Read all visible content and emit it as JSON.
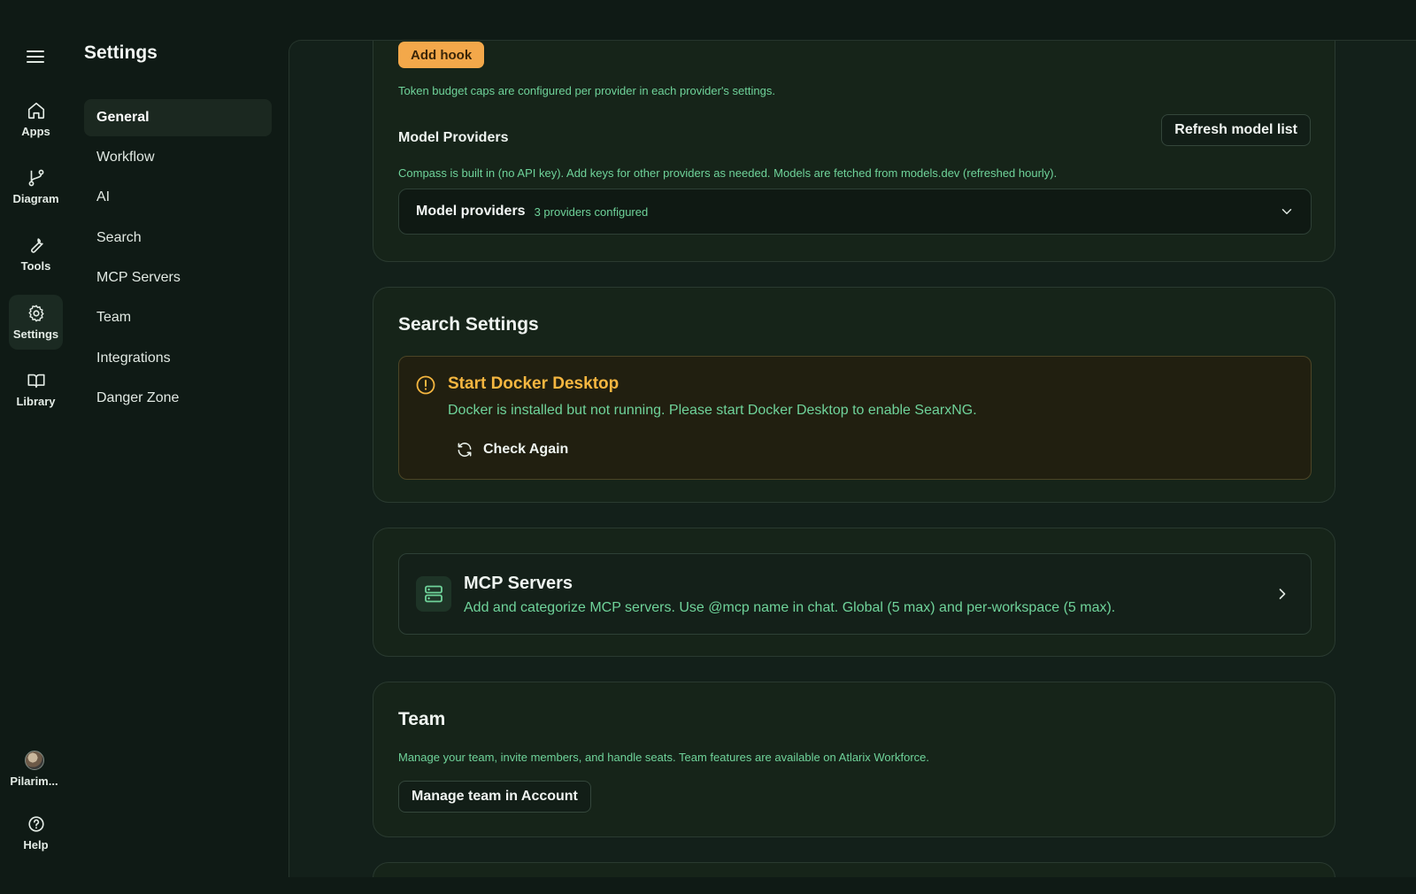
{
  "rail": {
    "items": [
      {
        "label": "Apps",
        "icon": "home-icon"
      },
      {
        "label": "Diagram",
        "icon": "git-branch-icon"
      },
      {
        "label": "Tools",
        "icon": "wrench-icon"
      },
      {
        "label": "Settings",
        "icon": "gear-icon"
      },
      {
        "label": "Library",
        "icon": "book-open-icon"
      }
    ],
    "user": "Pilarim...",
    "help": "Help"
  },
  "nav": {
    "title": "Settings",
    "items": [
      "General",
      "Workflow",
      "AI",
      "Search",
      "MCP Servers",
      "Team",
      "Integrations",
      "Danger Zone"
    ],
    "active": "General"
  },
  "ai_card": {
    "add_hook": "Add hook",
    "token_note": "Token budget caps are configured per provider in each provider's settings.",
    "providers_label": "Model Providers",
    "refresh_button": "Refresh model list",
    "providers_note": "Compass is built in (no API key). Add keys for other providers as needed. Models are fetched from models.dev (refreshed hourly).",
    "accordion_title": "Model providers",
    "accordion_count": "3 providers configured"
  },
  "search_card": {
    "title": "Search Settings",
    "warning_title": "Start Docker Desktop",
    "warning_text": "Docker is installed but not running. Please start Docker Desktop to enable SearxNG.",
    "check_again": "Check Again"
  },
  "mcp_card": {
    "title": "MCP Servers",
    "description": "Add and categorize MCP servers. Use @mcp name in chat. Global (5 max) and per-workspace (5 max)."
  },
  "team_card": {
    "title": "Team",
    "description": "Manage your team, invite members, and handle seats. Team features are available on Atlarix Workforce.",
    "button": "Manage team in Account"
  },
  "colors": {
    "background": "#0f1a15",
    "accent_green": "#6fd39a",
    "warning": "#f5b640",
    "add_hook": "#f3a84a"
  }
}
